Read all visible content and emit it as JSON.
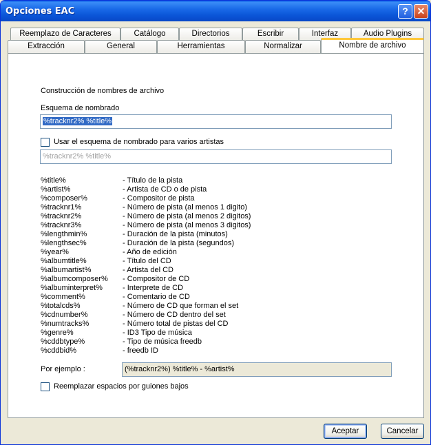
{
  "window": {
    "title": "Opciones EAC",
    "help_glyph": "?",
    "close_glyph": "✕"
  },
  "tabs": {
    "back_row": [
      "Reemplazo de Caracteres",
      "Catálogo",
      "Directorios",
      "Escribir",
      "Interfaz",
      "Audio Plugins"
    ],
    "front_row": [
      "Extracción",
      "General",
      "Herramientas",
      "Normalizar",
      "Nombre de archivo"
    ],
    "active": "Nombre de archivo"
  },
  "content": {
    "section_title": "Construcción de nombres de archivo",
    "scheme_label": "Esquema de nombrado",
    "scheme_value": "%tracknr2% %title%",
    "various_checkbox_label": "Usar el esquema de nombrado para varios artistas",
    "various_checked": false,
    "various_value": "%tracknr2% %title%",
    "variables": [
      {
        "key": "%title%",
        "desc": "- Título de la pista"
      },
      {
        "key": "%artist%",
        "desc": "- Artista de CD o de pista"
      },
      {
        "key": "%composer%",
        "desc": "- Compositor de pista"
      },
      {
        "key": "%tracknr1%",
        "desc": "- Número de pista (al menos 1 digito)"
      },
      {
        "key": "%tracknr2%",
        "desc": "- Número de pista (al menos 2 digitos)"
      },
      {
        "key": "%tracknr3%",
        "desc": "- Número de pista (al menos 3 digitos)"
      },
      {
        "key": "%lengthmin%",
        "desc": "- Duración de la pista (minutos)"
      },
      {
        "key": "%lengthsec%",
        "desc": "- Duración de la pista (segundos)"
      },
      {
        "key": "%year%",
        "desc": "- Año de edición"
      },
      {
        "key": "%albumtitle%",
        "desc": "- Título del CD"
      },
      {
        "key": "%albumartist%",
        "desc": "- Artista del CD"
      },
      {
        "key": "%albumcomposer%",
        "desc": "- Compositor de CD"
      },
      {
        "key": "%albuminterpret%",
        "desc": "- Interprete de CD"
      },
      {
        "key": "%comment%",
        "desc": "- Comentario de CD"
      },
      {
        "key": "%totalcds%",
        "desc": "- Número de CD que forman el set"
      },
      {
        "key": "%cdnumber%",
        "desc": "- Número de CD dentro del set"
      },
      {
        "key": "%numtracks%",
        "desc": "- Número total de pistas del CD"
      },
      {
        "key": "%genre%",
        "desc": "- ID3 Tipo de música"
      },
      {
        "key": "%cddbtype%",
        "desc": "- Tipo de música freedb"
      },
      {
        "key": "%cddbid%",
        "desc": "- freedb ID"
      }
    ],
    "example_label": "Por ejemplo :",
    "example_value": "(%tracknr2%) %title% - %artist%",
    "replace_spaces_label": "Reemplazar espacios por guiones bajos",
    "replace_spaces_checked": false
  },
  "buttons": {
    "ok": "Aceptar",
    "cancel": "Cancelar"
  }
}
